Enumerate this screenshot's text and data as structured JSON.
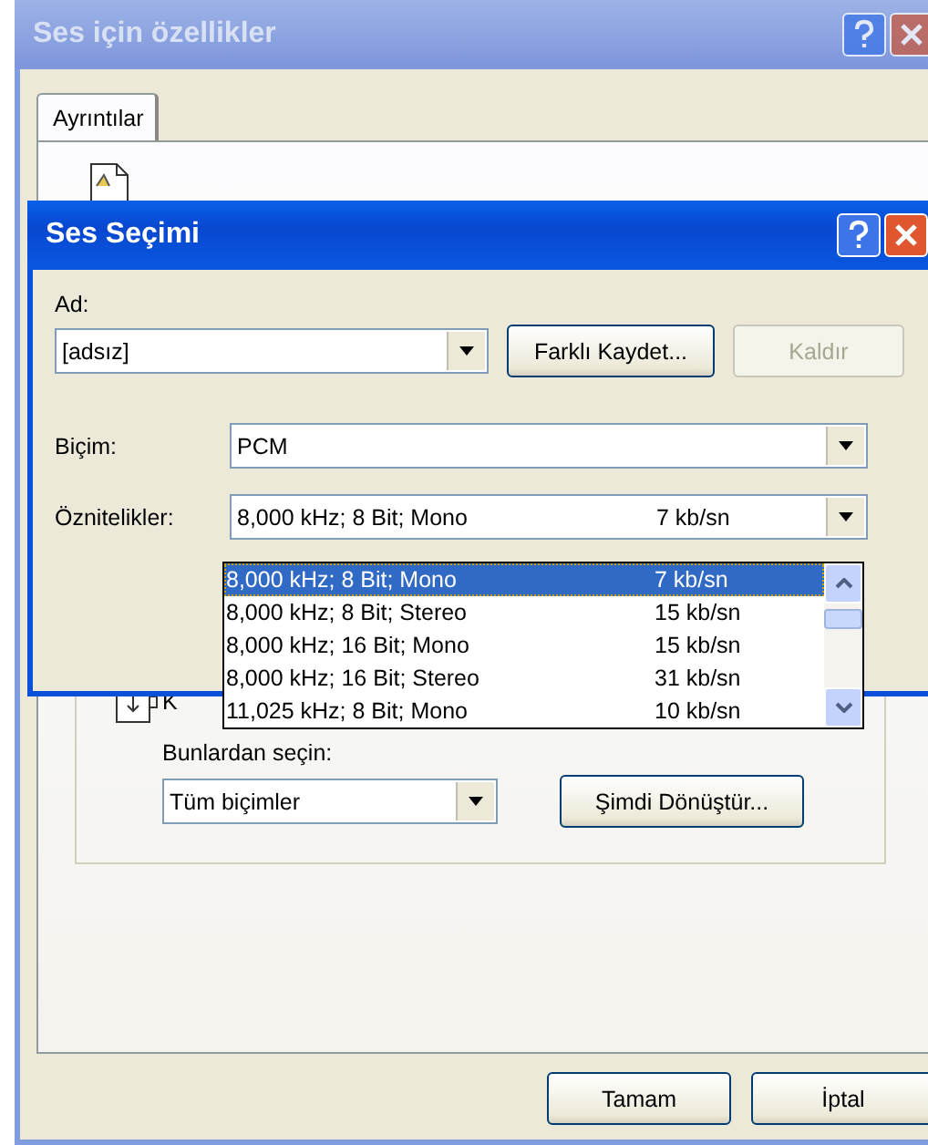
{
  "back_window": {
    "title": "Ses için özellikler",
    "active": false,
    "tabs": [
      {
        "label": "Ayrıntılar",
        "selected": true
      }
    ],
    "hidden_label": "K",
    "choose_label": "Bunlardan seçin:",
    "choose_value": "Tüm biçimler",
    "convert_button": "Şimdi Dönüştür...",
    "buttons": [
      "Tamam",
      "İptal"
    ]
  },
  "dialog": {
    "title": "Ses Seçimi",
    "active": true,
    "name_label": "Ad:",
    "name_value": "[adsız]",
    "save_as_button": {
      "label": "Farklı Kaydet...",
      "disabled": false
    },
    "remove_button": {
      "label": "Kaldır",
      "disabled": true
    },
    "format_label": "Biçim:",
    "format_value": "PCM",
    "attributes_label": "Öznitelikler:",
    "attributes_value": {
      "format": "8,000 kHz; 8 Bit; Mono",
      "rate": "7 kb/sn"
    }
  },
  "dropdown": {
    "items": [
      {
        "format": "8,000 kHz; 8 Bit; Mono",
        "rate": "7 kb/sn",
        "selected": true
      },
      {
        "format": "8,000 kHz; 8 Bit; Stereo",
        "rate": "15 kb/sn",
        "selected": false
      },
      {
        "format": "8,000 kHz; 16 Bit; Mono",
        "rate": "15 kb/sn",
        "selected": false
      },
      {
        "format": "8,000 kHz; 16 Bit; Stereo",
        "rate": "31 kb/sn",
        "selected": false
      },
      {
        "format": "11,025 kHz; 8 Bit; Mono",
        "rate": "10 kb/sn",
        "selected": false
      }
    ]
  }
}
